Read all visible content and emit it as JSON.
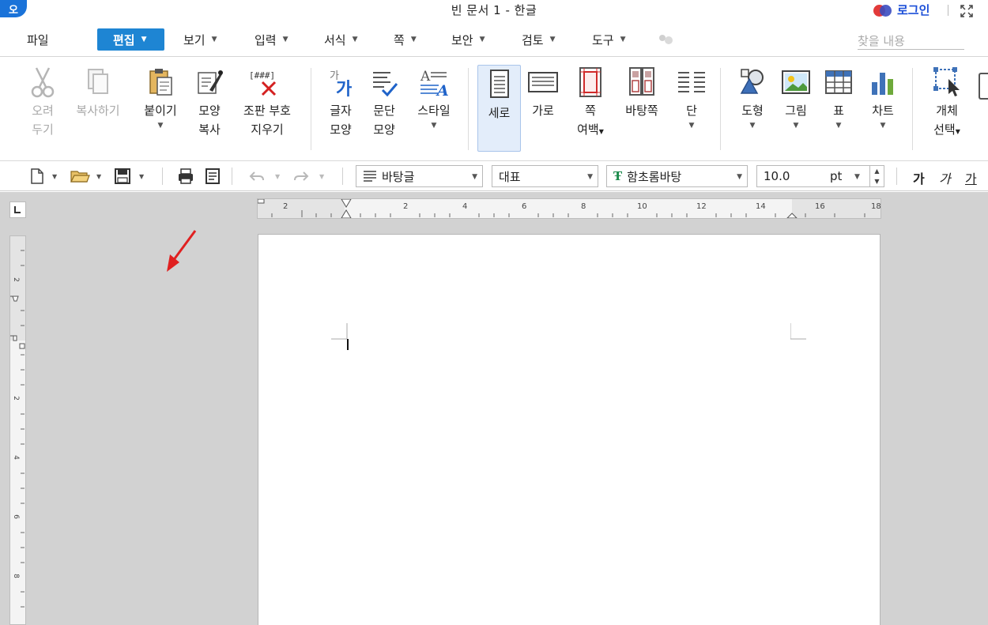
{
  "app": {
    "logo_text": "오",
    "title": "빈 문서 1 - 한글",
    "login_label": "로그인"
  },
  "menu": {
    "items": [
      {
        "label": "파일"
      },
      {
        "label": "편집"
      },
      {
        "label": "보기"
      },
      {
        "label": "입력"
      },
      {
        "label": "서식"
      },
      {
        "label": "쪽"
      },
      {
        "label": "보안"
      },
      {
        "label": "검토"
      },
      {
        "label": "도구"
      }
    ],
    "active_item": "편집",
    "search_placeholder": "찾을 내용"
  },
  "ribbon": {
    "cut": {
      "line1": "오려",
      "line2": "두기"
    },
    "copy": {
      "label": "복사하기"
    },
    "paste": {
      "label": "붙이기"
    },
    "format_copy": {
      "line1": "모양",
      "line2": "복사"
    },
    "clear_marks": {
      "line1": "조판 부호",
      "line2": "지우기",
      "icon_text": "[###]"
    },
    "char_shape": {
      "line1": "글자",
      "line2": "모양"
    },
    "para_shape": {
      "line1": "문단",
      "line2": "모양"
    },
    "style": {
      "label": "스타일"
    },
    "portrait": {
      "label": "세로"
    },
    "landscape": {
      "label": "가로"
    },
    "margins": {
      "line1": "쪽",
      "line2": "여백"
    },
    "master_page": {
      "label": "바탕쪽"
    },
    "columns": {
      "label": "단"
    },
    "shape": {
      "label": "도형"
    },
    "picture": {
      "label": "그림"
    },
    "table": {
      "label": "표"
    },
    "chart": {
      "label": "차트"
    },
    "object_select": {
      "line1": "개체",
      "line2": "선택"
    }
  },
  "toolbar": {
    "style_value": "바탕글",
    "language_value": "대표",
    "font_value": "함초롬바탕",
    "size_value": "10.0",
    "size_unit": "pt",
    "bold_label": "가",
    "italic_label": "가",
    "underline_label": "가"
  },
  "ruler": {
    "h_ticks": [
      "2",
      "2",
      "4",
      "6",
      "8",
      "10",
      "12",
      "14",
      "16",
      "18"
    ],
    "v_ticks": [
      "2",
      "2",
      "4",
      "6",
      "8"
    ]
  },
  "colors": {
    "accent": "#1e85d3",
    "annotation": "#e02020",
    "canvas": "#d2d2d2"
  }
}
